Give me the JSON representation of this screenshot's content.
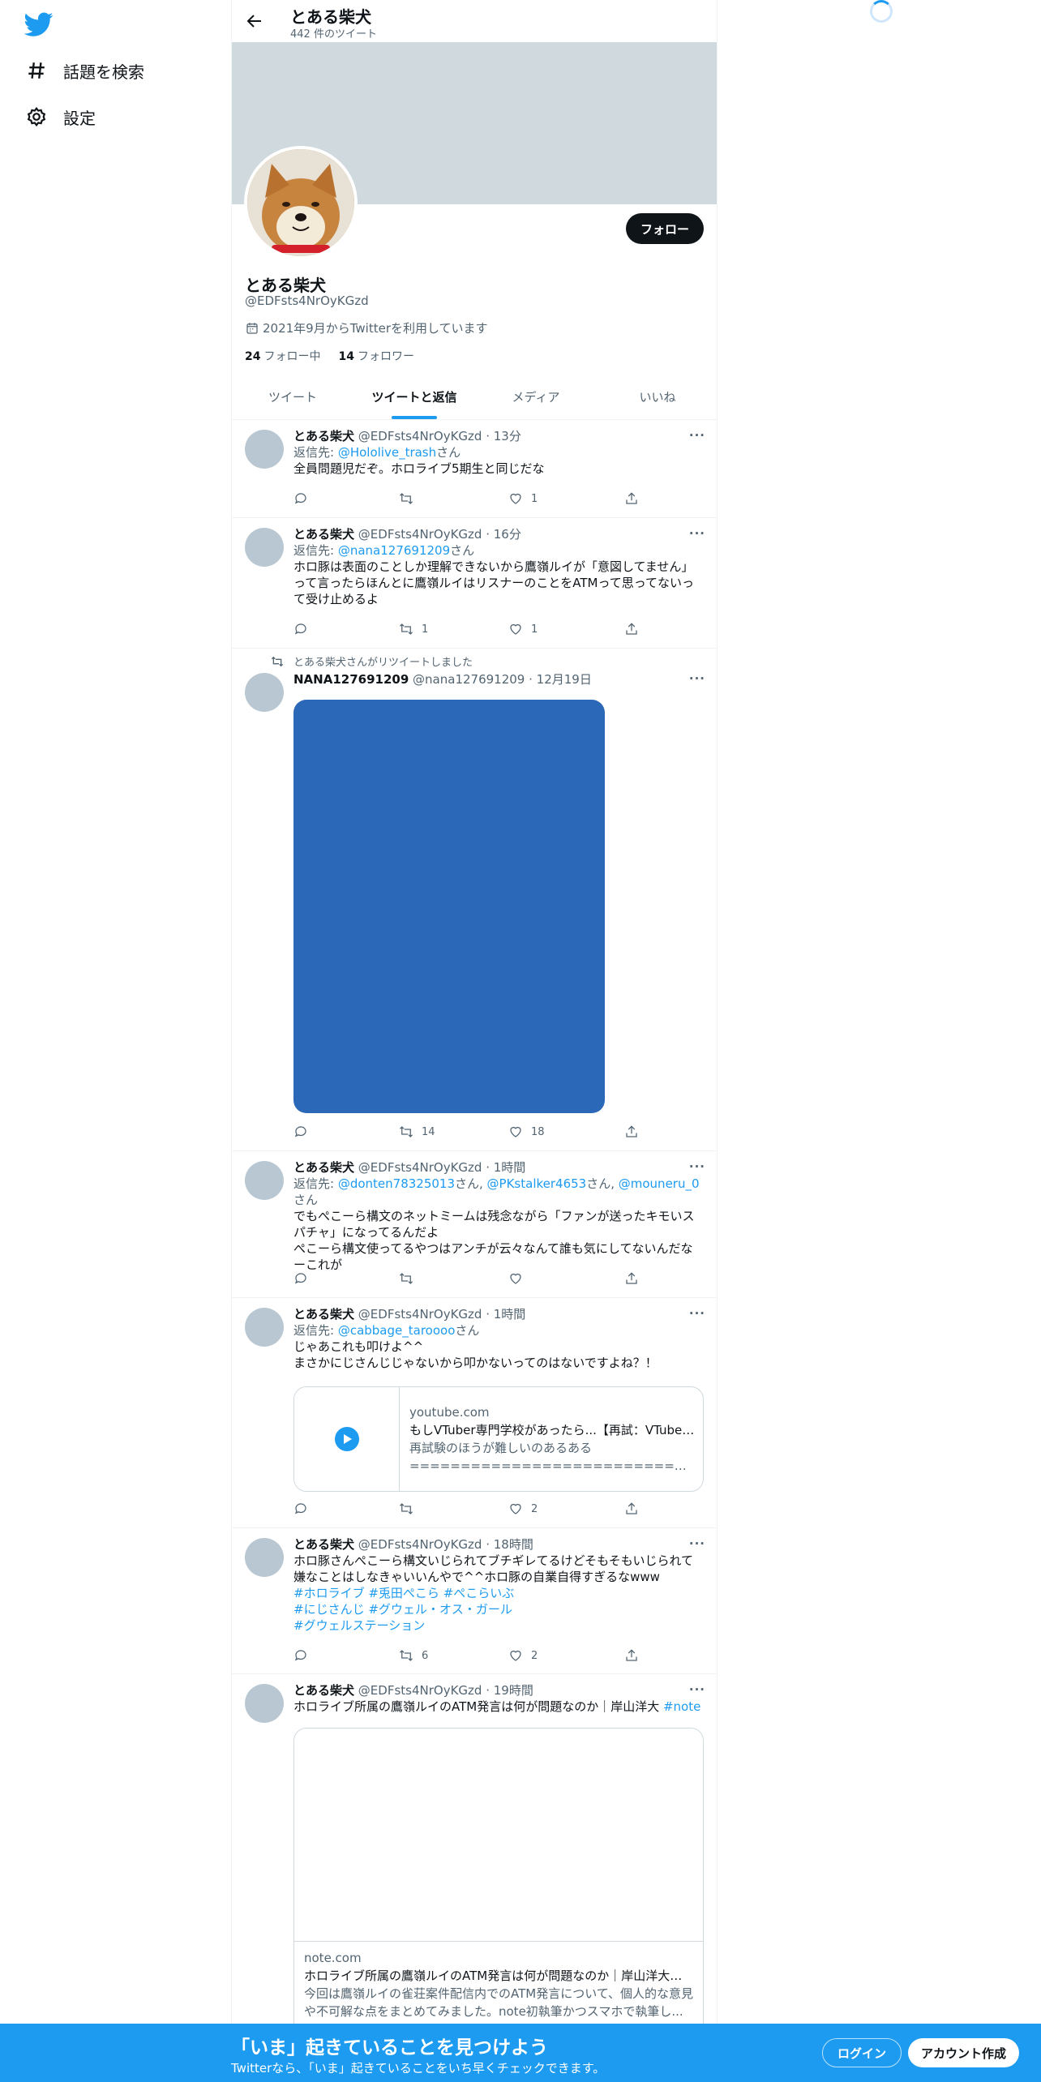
{
  "nav": {
    "logo": "twitter-bird-icon",
    "items": [
      {
        "label": "話題を検索",
        "icon": "hashtag-icon"
      },
      {
        "label": "設定",
        "icon": "gear-icon"
      }
    ]
  },
  "header": {
    "name": "とある柴犬",
    "tweet_count": "442 件のツイート"
  },
  "profile": {
    "name": "とある柴犬",
    "handle": "@EDFsts4NrOyKGzd",
    "joined": "2021年9月からTwitterを利用しています",
    "following_count": "24",
    "following_label": "フォロー中",
    "followers_count": "14",
    "followers_label": "フォロワー",
    "follow_button": "フォロー"
  },
  "tabs": [
    "ツイート",
    "ツイートと返信",
    "メディア",
    "いいね"
  ],
  "active_tab": 1,
  "tweets": [
    {
      "name": "とある柴犬",
      "handle": "@EDFsts4NrOyKGzd",
      "time": "· 13分",
      "reply_prefix": "返信先: ",
      "reply_to": "@Hololive_trash",
      "reply_suffix": "さん",
      "text": "全員問題児だぞ。ホロライブ5期生と同じだな",
      "retweets": "",
      "likes": "1"
    },
    {
      "name": "とある柴犬",
      "handle": "@EDFsts4NrOyKGzd",
      "time": "· 16分",
      "reply_prefix": "返信先: ",
      "reply_to": "@nana127691209",
      "reply_suffix": "さん",
      "text": "ホロ豚は表面のことしか理解できないから鷹嶺ルイが「意図してません」\nって言ったらほんとに鷹嶺ルイはリスナーのことをATMって思ってないっ\nて受け止めるよ",
      "retweets": "1",
      "likes": "1"
    },
    {
      "retweeted_by": "とある柴犬さんがリツイートしました",
      "name": "NANA127691209",
      "handle": "@nana127691209",
      "time": "· 12月19日",
      "retweets": "14",
      "likes": "18"
    },
    {
      "name": "とある柴犬",
      "handle": "@EDFsts4NrOyKGzd",
      "time": "· 1時間",
      "reply_prefix": "返信先: ",
      "reply_to": [
        "@donten78325013",
        "@PKstalker4653",
        "@mouneru_0"
      ],
      "reply_sep": "さん, ",
      "reply_suffix": "さん",
      "text": "でもぺこーら構文のネットミームは残念ながら「ファンが送ったキモいス\nパチャ」になってるんだよ\nぺこーら構文使ってるやつはアンチが云々なんて誰も気にしてないんだな\nーこれが",
      "retweets": "",
      "likes": ""
    },
    {
      "name": "とある柴犬",
      "handle": "@EDFsts4NrOyKGzd",
      "time": "· 1時間",
      "reply_prefix": "返信先: ",
      "reply_to": "@cabbage_taroooo",
      "reply_suffix": "さん",
      "text": "じゃあこれも叩けよ^^\nまさかにじさんじじゃないから叩かないってのはないですよね？！",
      "card": {
        "domain": "youtube.com",
        "title": "もしVTuber専門学校があったら...【再試：VTuber...",
        "desc1": "再試験のほうが難しいのあるある",
        "desc2": "========================================"
      },
      "retweets": "",
      "likes": "2"
    },
    {
      "name": "とある柴犬",
      "handle": "@EDFsts4NrOyKGzd",
      "time": "· 18時間",
      "text": "ホロ豚さんぺこーら構文いじられてブチギレてるけどそもそもいじられて\n嫌なことはしなきゃいいんやで^^ホロ豚の自業自得すぎるなwww",
      "hashtags_line1": [
        "#ホロライブ",
        "#兎田ぺこら",
        "#ぺこらいぶ"
      ],
      "hashtags_line2": [
        "#にじさんじ",
        "#グウェル・オス・ガール"
      ],
      "hashtags_line3": [
        "#グウェルステーション"
      ],
      "retweets": "6",
      "likes": "2"
    },
    {
      "name": "とある柴犬",
      "handle": "@EDFsts4NrOyKGzd",
      "time": "· 19時間",
      "text": "ホロライブ所属の鷹嶺ルイのATM発言は何が問題なのか｜岸山洋大 ",
      "hashtag": "#note",
      "card": {
        "domain": "note.com",
        "title": "ホロライブ所属の鷹嶺ルイのATM発言は何が問題なのか｜岸山洋大｜...",
        "desc": "今回は鷹嶺ルイの雀荘案件配信内でのATM発言について、個人的な意見や不可解な点をまとめてみました。note初執筆かつスマホで執筆し..."
      }
    }
  ],
  "bottom_bar": {
    "title": "「いま」起きていることを見つけよう",
    "subtitle": "Twitterなら、「いま」起きていることをいち早くチェックできます。",
    "login": "ログイン",
    "signup": "アカウント作成"
  },
  "colors": {
    "accent": "#1d9bf0",
    "banner": "#cfd9de",
    "media": "#2b68b7"
  }
}
